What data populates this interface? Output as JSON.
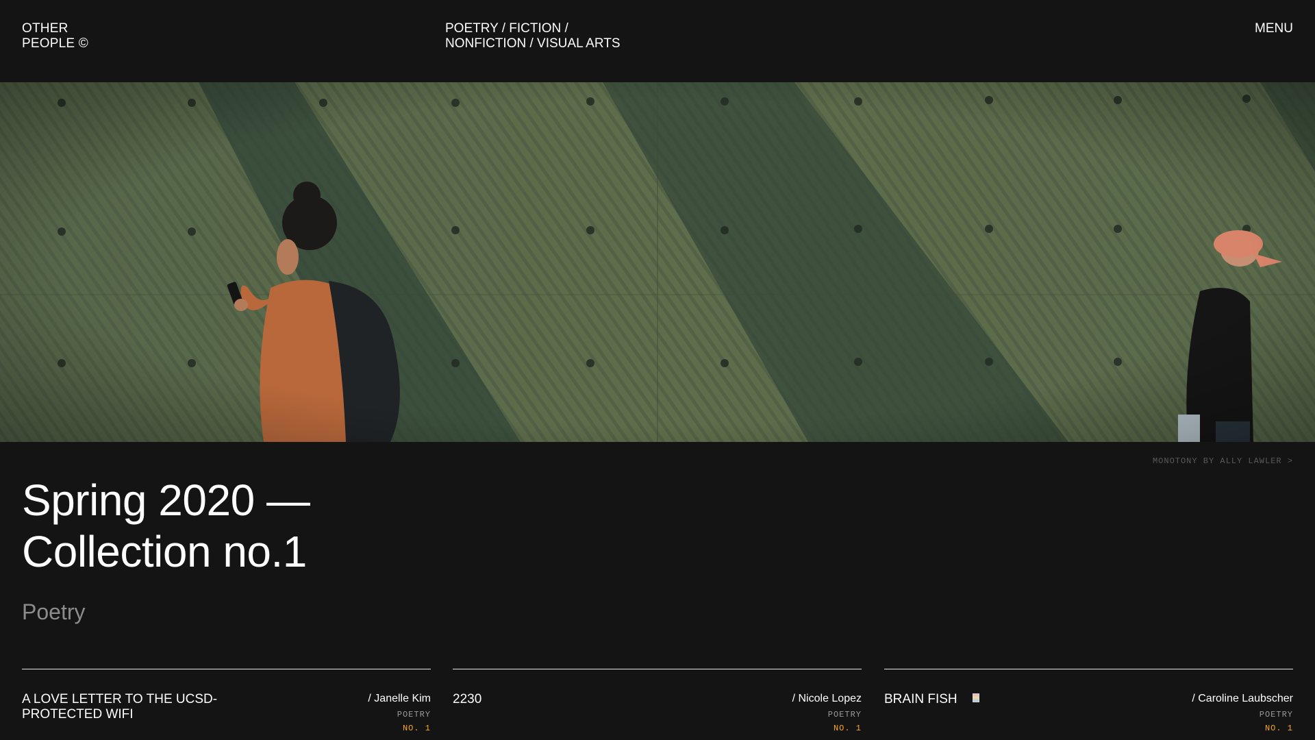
{
  "header": {
    "brand_line1": "OTHER",
    "brand_line2": "PEOPLE ©",
    "nav_line1": "POETRY / FICTION /",
    "nav_line2": "NONFICTION / VISUAL ARTS",
    "menu_label": "MENU"
  },
  "hero": {
    "credit": "MONOTONY BY ALLY LAWLER >"
  },
  "collection": {
    "title_line1": "Spring 2020 —",
    "title_line2": "Collection no.1",
    "section": "Poetry"
  },
  "cards": [
    {
      "title_line1": "A LOVE LETTER TO THE UCSD-",
      "title_line2": "PROTECTED WIFI",
      "author": "/ Janelle Kim",
      "category": "POETRY",
      "issue": "NO. 1"
    },
    {
      "title_line1": "2230",
      "author": "/ Nicole Lopez",
      "category": "POETRY",
      "issue": "NO. 1"
    },
    {
      "title_line1": "BRAIN FISH",
      "author": "/ Caroline Laubscher",
      "category": "POETRY",
      "issue": "NO. 1"
    }
  ],
  "colors": {
    "background": "#141414",
    "text": "#ffffff",
    "muted": "#8c8c8c",
    "accent": "#f5a623"
  }
}
